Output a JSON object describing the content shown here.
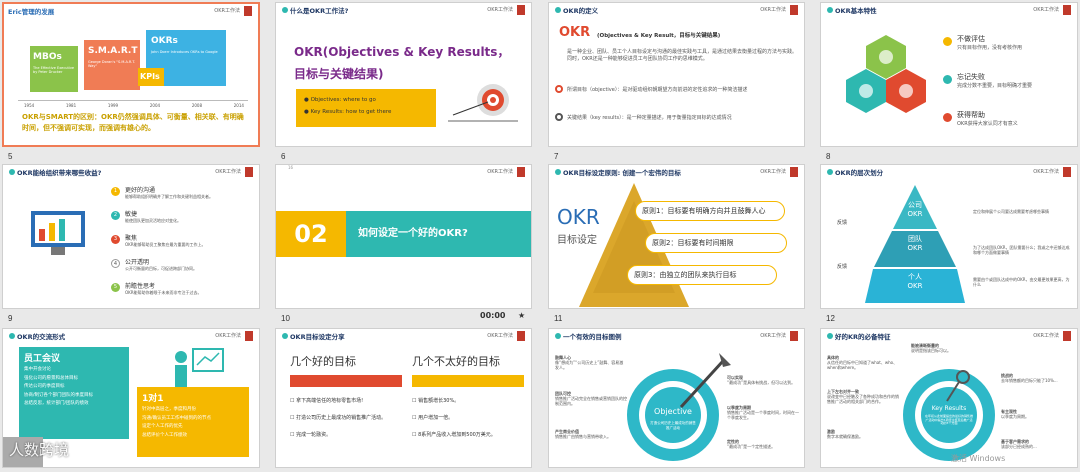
{
  "slides": [
    {
      "num": "5",
      "header": "Eric管理的发展",
      "right": "OKR工作法",
      "boxes": [
        "MBOs",
        "S.M.A.R.T",
        "OKRs",
        "KPIs"
      ],
      "mbo_sub": "The Effective Executive by Peter Drucker",
      "smart_sub": "George Doran's \"S.M.A.R.T. Way\"",
      "okr_sub": "John Doerr Introduces OKRs to Google",
      "years": [
        "1954",
        "1981",
        "1999",
        "2004",
        "2008",
        "2014"
      ],
      "body": "OKR与SMART的区别：OKR仍然强调具体、可衡量、相关联、有明确时间，但不强调可实现，而强调有雄心的。"
    },
    {
      "num": "6",
      "n": "3",
      "header": "什么是OKR工作法?",
      "right": "OKR工作法",
      "title1": "OKR(Objectives & Key Results，",
      "title2": "目标与关键结果)",
      "b1": "Objectives: where to go",
      "b2": "Key Results: how to get there"
    },
    {
      "num": "7",
      "n": "4",
      "header": "OKR的定义",
      "right": "OKR工作法",
      "big": "OKR",
      "sub": "(Objectives & Key Result，目标与关键结果)",
      "p1": "是一种企业、团队、员工个人目标设定与沟通的最佳实践与工具，是通过结果去衡量过程的方法与实践。同时，OKR还是一种能够促进员工与团队协同工作的思维模式。",
      "p2": "所谓目标（objective）：是对驱动组织朝期望方向前进的定性追求的一种简洁描述",
      "p3": "关键结果（key results）：是一种定量描述，用于衡量指定目标的达成情况"
    },
    {
      "num": "8",
      "n": "5",
      "header": "OKR基本特性",
      "right": "OKR工作法",
      "f1": "不做评估",
      "f1s": "只有目标作用，没有考核作用",
      "f2": "忘记失败",
      "f2s": "完成分数不重要，目标明确才重要",
      "f3": "获得帮助",
      "f3s": "OKR获得大家认同才有意义"
    },
    {
      "num": "9",
      "header": "OKR能给组织带来哪些收益?",
      "right": "OKR工作法",
      "items": [
        {
          "k": "1",
          "t": "更好的沟通",
          "s": "能够帮助组织明确并了解工作和关键利益相关者。"
        },
        {
          "k": "2",
          "t": "敏捷",
          "s": "能使团队更加灵活地应对变化。"
        },
        {
          "k": "3",
          "t": "聚焦",
          "s": "OKR能够帮助员工聚焦在最为重要的工作上。"
        },
        {
          "k": "4",
          "t": "公开透明",
          "s": "公开可衡量的目标，可促进跨部门协同。"
        },
        {
          "k": "5",
          "t": "前瞻性思考",
          "s": "OKR能帮助你着眼于未来而非专注于过去。"
        }
      ]
    },
    {
      "num": "10",
      "n": "16",
      "header": "",
      "right": "OKR工作法",
      "big": "02",
      "title": "如何设定一个好的OKR?",
      "time": "00:00"
    },
    {
      "num": "11",
      "header": "OKR目标设定原则: 创建一个宏伟的目标",
      "right": "OKR工作法",
      "big": "OKR",
      "sub": "目标设定",
      "r1": "原则1：目标要有明确方向并且鼓舞人心",
      "r2": "原则2：目标要有时间期限",
      "r3": "原则3：由独立的团队来执行目标"
    },
    {
      "num": "12",
      "n": "12",
      "header": "OKR的层次划分",
      "right": "OKR工作法",
      "l1": "公司",
      "l1b": "OKR",
      "l2": "团队",
      "l2b": "OKR",
      "l3": "个人",
      "l3b": "OKR",
      "side1": "反馈",
      "side2": "反馈",
      "d1": "定位和伸展个公司要达成需要考虑哪些事情",
      "d2": "为了达成团队OKR，团队需要什么；我或之中还够达成和哪个方面做要事情",
      "d3": "需要由个或团队达成中的OKR，由交最更效果更高，为什么"
    },
    {
      "num": "",
      "n": "13",
      "header": "OKR的交流形式",
      "right": "OKR工作法",
      "meet": "员工会议",
      "m1": "集中开会讨论",
      "m2": "强化公司的愿景和总体目标",
      "m3": "传达公司的季度目标",
      "m4": "协商/制订各个部门团队的季度目标",
      "m5": "总结反思，统计部门/团队的绩效",
      "one": "1对1",
      "o1": "针对中高层之，季度和月份",
      "o2": "沟通/确认员工工作中碰到的的节点",
      "o3": "设定个人工作的优先",
      "o4": "总结评价个人工作绩效",
      "wm": "人数跨境"
    },
    {
      "num": "",
      "n": "14",
      "header": "OKR目标设定分享",
      "right": "OKR工作法",
      "g": "几个好的目标",
      "b": "几个不太好的目标",
      "g1": "拿下高端信任的地标零售市场!",
      "g2": "打造公司历史上最成功的销售推广活动。",
      "g3": "完成一轮融资。",
      "b1": "销售额增长30%。",
      "b2": "用户增加一倍。",
      "b3": "8系列产品收入增加到500万美元。"
    },
    {
      "num": "",
      "n": "14",
      "header": "一个有效的目标图例",
      "right": "OKR工作法",
      "center": "Objective",
      "cs": "打造公司历史上最成功的销售推广活动",
      "l1t": "鼓舞人心",
      "l1": "像“想成为”“公司历史上”鼓舞、容易激发人。",
      "l2t": "团队可控",
      "l2": "销售推广活动完全在销售或营销团队的控制范围内。",
      "l3t": "产生商业价值",
      "l3": "销售推广由销售与营销带收入。",
      "r1t": "可以实现",
      "r1": "“最成功”是具体有挑战，但可以达到。",
      "r2t": "以季度为周期",
      "r2": "销售推广活动是一个季度时间，时间在一个季度发生。",
      "r3t": "定性的",
      "r3": "“最成功”是一个定性描述。"
    },
    {
      "num": "12",
      "n": "15",
      "header": "好的KR的必备特征",
      "right": "OKR工作法",
      "center": "Key Results",
      "cs": "在年初从此前面提出的最好的销售推广活动中提出5项经过核查后推广活动的3个方面",
      "l1t": "具体的",
      "l1": "从信任的目标中已知道了what、who、when和where。",
      "l2t": "上下左右对齐一致",
      "l2": "说改变中已经触及了各种成功和合作的销售推广活动的相关部门的合作。",
      "l3t": "激励",
      "l3": "数字本就确保激励。",
      "r1t": "能被清晰衡量的",
      "r1": "说明是指该目标可以。",
      "r2t": "挑战的",
      "r2": "去年销售额的目标只能了10%...",
      "r3t": "有主观性",
      "r3": "以季度为周期。",
      "r4t": "基于客户需求的",
      "r4": "该部分已经成熟的...",
      "wm": "激活 Windows"
    }
  ],
  "colors": {
    "teal": "#2eb8b0",
    "orange": "#f07c55",
    "yellow": "#f5b800",
    "red": "#e04a2f",
    "navy": "#1f3864",
    "lime": "#8bc34a"
  }
}
